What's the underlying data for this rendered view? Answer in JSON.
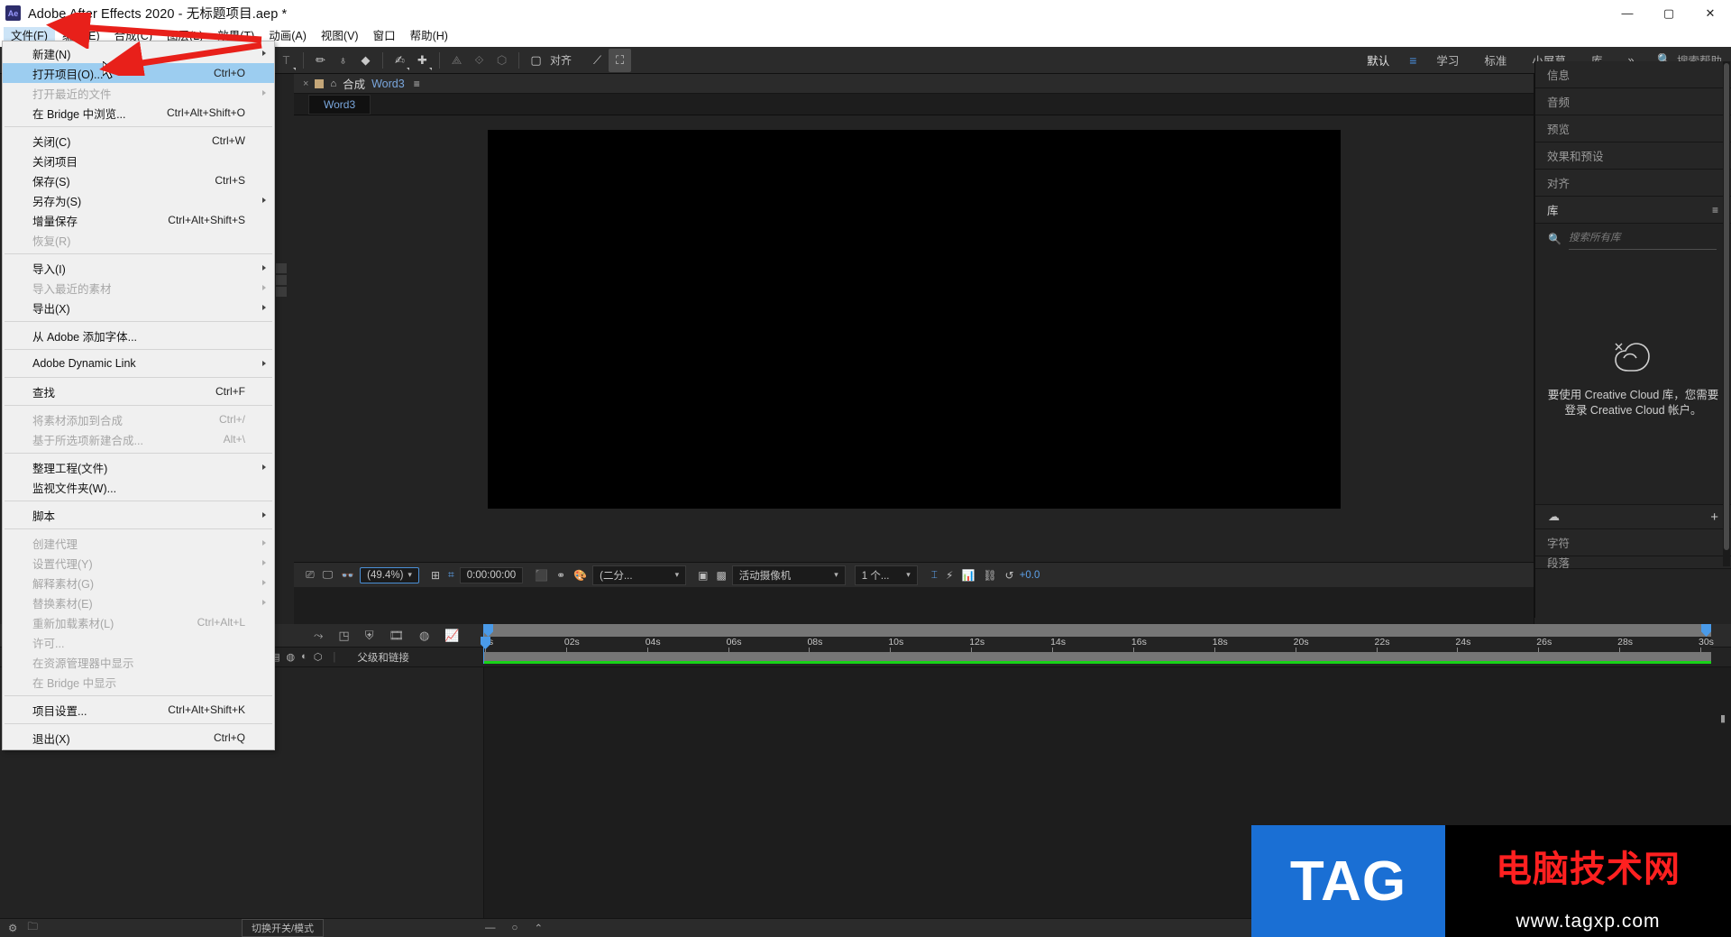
{
  "window": {
    "app_badge": "Ae",
    "title": "Adobe After Effects 2020 - 无标题项目.aep *",
    "minimize": "—",
    "maximize": "▢",
    "close": "✕"
  },
  "menubar": {
    "items": [
      {
        "label": "文件(F)",
        "open": true
      },
      {
        "label": "编辑(E)",
        "open": false
      },
      {
        "label": "合成(C)",
        "open": false
      },
      {
        "label": "图层(L)",
        "open": false
      },
      {
        "label": "效果(T)",
        "open": false
      },
      {
        "label": "动画(A)",
        "open": false
      },
      {
        "label": "视图(V)",
        "open": false
      },
      {
        "label": "窗口",
        "open": false
      },
      {
        "label": "帮助(H)",
        "open": false
      }
    ]
  },
  "file_menu": {
    "groups": [
      [
        {
          "label": "新建(N)",
          "shortcut": "",
          "submenu": true,
          "disabled": false,
          "selected": false
        },
        {
          "label": "打开项目(O)...",
          "shortcut": "Ctrl+O",
          "submenu": false,
          "disabled": false,
          "selected": true
        },
        {
          "label": "打开最近的文件",
          "shortcut": "",
          "submenu": true,
          "disabled": true,
          "selected": false
        },
        {
          "label": "在 Bridge 中浏览...",
          "shortcut": "Ctrl+Alt+Shift+O",
          "submenu": false,
          "disabled": false,
          "selected": false
        }
      ],
      [
        {
          "label": "关闭(C)",
          "shortcut": "Ctrl+W",
          "submenu": false,
          "disabled": false,
          "selected": false
        },
        {
          "label": "关闭项目",
          "shortcut": "",
          "submenu": false,
          "disabled": false,
          "selected": false
        },
        {
          "label": "保存(S)",
          "shortcut": "Ctrl+S",
          "submenu": false,
          "disabled": false,
          "selected": false
        },
        {
          "label": "另存为(S)",
          "shortcut": "",
          "submenu": true,
          "disabled": false,
          "selected": false
        },
        {
          "label": "增量保存",
          "shortcut": "Ctrl+Alt+Shift+S",
          "submenu": false,
          "disabled": false,
          "selected": false
        },
        {
          "label": "恢复(R)",
          "shortcut": "",
          "submenu": false,
          "disabled": true,
          "selected": false
        }
      ],
      [
        {
          "label": "导入(I)",
          "shortcut": "",
          "submenu": true,
          "disabled": false,
          "selected": false
        },
        {
          "label": "导入最近的素材",
          "shortcut": "",
          "submenu": true,
          "disabled": true,
          "selected": false
        },
        {
          "label": "导出(X)",
          "shortcut": "",
          "submenu": true,
          "disabled": false,
          "selected": false
        }
      ],
      [
        {
          "label": "从 Adobe 添加字体...",
          "shortcut": "",
          "submenu": false,
          "disabled": false,
          "selected": false
        }
      ],
      [
        {
          "label": "Adobe Dynamic Link",
          "shortcut": "",
          "submenu": true,
          "disabled": false,
          "selected": false
        }
      ],
      [
        {
          "label": "查找",
          "shortcut": "Ctrl+F",
          "submenu": false,
          "disabled": false,
          "selected": false
        }
      ],
      [
        {
          "label": "将素材添加到合成",
          "shortcut": "Ctrl+/",
          "submenu": false,
          "disabled": true,
          "selected": false
        },
        {
          "label": "基于所选项新建合成...",
          "shortcut": "Alt+\\",
          "submenu": false,
          "disabled": true,
          "selected": false
        }
      ],
      [
        {
          "label": "整理工程(文件)",
          "shortcut": "",
          "submenu": true,
          "disabled": false,
          "selected": false
        },
        {
          "label": "监视文件夹(W)...",
          "shortcut": "",
          "submenu": false,
          "disabled": false,
          "selected": false
        }
      ],
      [
        {
          "label": "脚本",
          "shortcut": "",
          "submenu": true,
          "disabled": false,
          "selected": false
        }
      ],
      [
        {
          "label": "创建代理",
          "shortcut": "",
          "submenu": true,
          "disabled": true,
          "selected": false
        },
        {
          "label": "设置代理(Y)",
          "shortcut": "",
          "submenu": true,
          "disabled": true,
          "selected": false
        },
        {
          "label": "解释素材(G)",
          "shortcut": "",
          "submenu": true,
          "disabled": true,
          "selected": false
        },
        {
          "label": "替换素材(E)",
          "shortcut": "",
          "submenu": true,
          "disabled": true,
          "selected": false
        },
        {
          "label": "重新加载素材(L)",
          "shortcut": "Ctrl+Alt+L",
          "submenu": false,
          "disabled": true,
          "selected": false
        },
        {
          "label": "许可...",
          "shortcut": "",
          "submenu": false,
          "disabled": true,
          "selected": false
        },
        {
          "label": "在资源管理器中显示",
          "shortcut": "",
          "submenu": false,
          "disabled": true,
          "selected": false
        },
        {
          "label": "在 Bridge 中显示",
          "shortcut": "",
          "submenu": false,
          "disabled": true,
          "selected": false
        }
      ],
      [
        {
          "label": "项目设置...",
          "shortcut": "Ctrl+Alt+Shift+K",
          "submenu": false,
          "disabled": false,
          "selected": false
        }
      ],
      [
        {
          "label": "退出(X)",
          "shortcut": "Ctrl+Q",
          "submenu": false,
          "disabled": false,
          "selected": false
        }
      ]
    ]
  },
  "toolbar": {
    "align_label": "对齐",
    "workspaces": [
      {
        "label": "默认",
        "current": true
      },
      {
        "label": "学习",
        "current": false
      },
      {
        "label": "标准",
        "current": false
      },
      {
        "label": "小屏幕",
        "current": false
      },
      {
        "label": "库",
        "current": false
      }
    ],
    "overflow": "»",
    "search_help": "搜索帮助"
  },
  "comp_panel": {
    "tab_title": "合成",
    "tab_name": "Word3",
    "subtab": "Word3",
    "close_glyph": "×",
    "lock_glyph": "🔒",
    "menu_glyph": "≡"
  },
  "comp_toolbar": {
    "zoom": "(49.4%)",
    "time": "0:00:00:00",
    "resolution": "(二分...",
    "camera": "活动摄像机",
    "views": "1 个...",
    "exposure": "+0.0"
  },
  "right_panels": {
    "rows": [
      {
        "label": "信息",
        "active": false,
        "hamburger": false
      },
      {
        "label": "音频",
        "active": false,
        "hamburger": false
      },
      {
        "label": "预览",
        "active": false,
        "hamburger": false
      },
      {
        "label": "效果和预设",
        "active": false,
        "hamburger": false
      },
      {
        "label": "对齐",
        "active": false,
        "hamburger": false
      },
      {
        "label": "库",
        "active": true,
        "hamburger": true
      }
    ],
    "library_search_placeholder": "搜索所有库",
    "cc_message": "要使用 Creative Cloud 库，您需要登录 Creative Cloud 帐户。",
    "bottom_rows": [
      {
        "label": "字符"
      },
      {
        "label": "段落"
      }
    ],
    "plus_glyph": "+"
  },
  "timeline": {
    "parent_column": "父级和链接",
    "ruler_ticks": [
      "0s",
      "02s",
      "04s",
      "06s",
      "08s",
      "10s",
      "12s",
      "14s",
      "16s",
      "18s",
      "20s",
      "22s",
      "24s",
      "26s",
      "28s",
      "30s"
    ]
  },
  "statusbar": {
    "toggle_label": "切换开关/模式"
  },
  "watermark": {
    "tag": "TAG",
    "cn": "电脑技术网",
    "url": "www.tagxp.com"
  },
  "colors": {
    "accent_blue": "#4a9ae8",
    "menu_select": "#9ccdf0",
    "annotation_red": "#e8201a",
    "green_bar": "#18d318"
  }
}
